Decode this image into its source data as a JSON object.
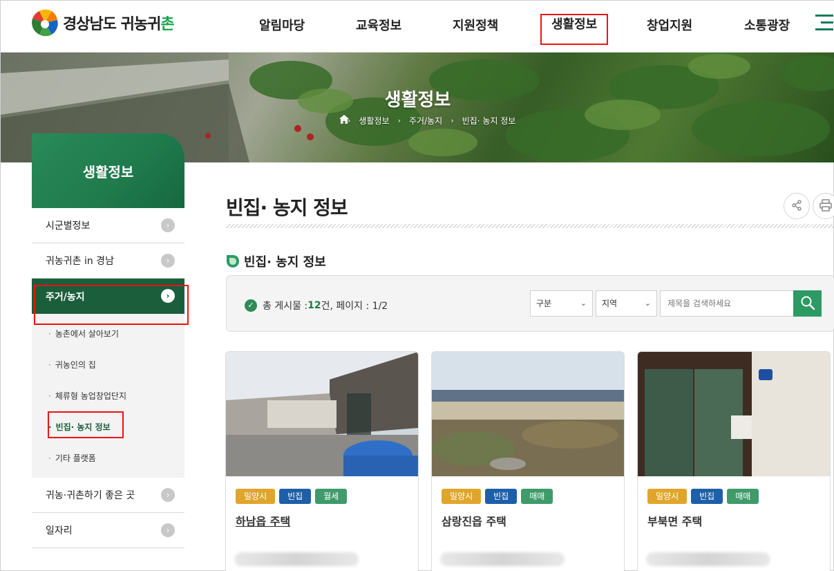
{
  "header": {
    "logo_text_prefix": "경상남도 ",
    "logo_text_script": "귀농귀",
    "logo_text_end": "촌",
    "nav": [
      "알림마당",
      "교육정보",
      "지원정책",
      "생활정보",
      "창업지원",
      "소통광장"
    ]
  },
  "banner": {
    "title": "생활정보",
    "breadcrumb": [
      "생활정보",
      "주거/농지",
      "빈집· 농지 정보"
    ]
  },
  "sidebar": {
    "title": "생활정보",
    "items": [
      {
        "label": "시군별정보"
      },
      {
        "label": "귀농귀촌 in 경남"
      },
      {
        "label": "주거/농지"
      },
      {
        "label": "귀농·귀촌하기 좋은 곳"
      },
      {
        "label": "일자리"
      }
    ],
    "sub_items": [
      {
        "label": "농촌에서 살아보기"
      },
      {
        "label": "귀농인의 집"
      },
      {
        "label": "체류형 농업창업단지"
      },
      {
        "label": "빈집· 농지 정보"
      },
      {
        "label": "기타 플랫폼"
      }
    ]
  },
  "content": {
    "page_title": "빈집· 농지 정보",
    "section_title": "빈집· 농지 정보",
    "total_prefix": "총 게시물 :",
    "total_count": "12",
    "total_suffix": "건, 페이지 : 1/2",
    "filter_category": "구분",
    "filter_region": "지역",
    "search_placeholder": "제목을 검색하세요"
  },
  "cards": [
    {
      "region": "밀양시",
      "kind": "빈집",
      "deal": "월세",
      "title": "하남읍 주택"
    },
    {
      "region": "밀양시",
      "kind": "빈집",
      "deal": "매매",
      "title": "삼랑진읍 주택"
    },
    {
      "region": "밀양시",
      "kind": "빈집",
      "deal": "매매",
      "title": "부북면 주택"
    }
  ],
  "colors": {
    "brand_green": "#1b5e3c",
    "accent_green": "#2e9a63",
    "highlight_red": "#e11111",
    "tag_region": "#e0a62c",
    "tag_kind": "#1d5fa8",
    "tag_deal": "#3f9b6a"
  },
  "icons": [
    "logo-mark-icon",
    "menu-icon",
    "home-icon",
    "chevron-right-icon",
    "share-icon",
    "print-icon",
    "leaf-icon",
    "check-icon",
    "chevron-down-icon",
    "search-icon",
    "location-pin-icon"
  ]
}
